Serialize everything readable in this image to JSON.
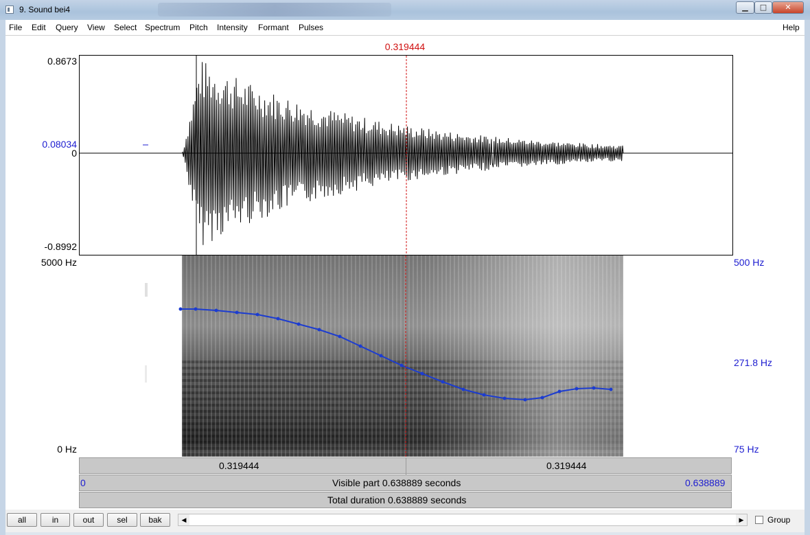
{
  "window": {
    "title": "9. Sound bei4",
    "min_glyph": "▁",
    "max_glyph": "□",
    "close_glyph": "✕"
  },
  "menu": {
    "items": [
      "File",
      "Edit",
      "Query",
      "View",
      "Select",
      "Spectrum",
      "Pitch",
      "Intensity",
      "Formant",
      "Pulses"
    ],
    "help": "Help"
  },
  "cursor": {
    "time_label": "0.319444",
    "position_fraction": 0.5
  },
  "waveform": {
    "max_label": "0.8673",
    "cursor_value_label": "0.08034",
    "zero_label": "0",
    "min_label": "-0.8992"
  },
  "spectrogram": {
    "top_label": "5000 Hz",
    "bottom_label": "0 Hz",
    "pitch_top_label": "500 Hz",
    "pitch_mid_label": "271.8 Hz",
    "pitch_bottom_label": "75 Hz"
  },
  "time_bars": {
    "left_segment": "0.319444",
    "right_segment": "0.319444",
    "visible_start": "0",
    "visible_label": "Visible part 0.638889 seconds",
    "visible_end": "0.638889",
    "total_label": "Total duration 0.638889 seconds"
  },
  "toolbar": {
    "buttons": [
      "all",
      "in",
      "out",
      "sel",
      "bak"
    ],
    "scroll_left_glyph": "◀",
    "scroll_right_glyph": "▶",
    "group_label": "Group"
  },
  "colors": {
    "cursor": "#d01010",
    "pitch_line": "#1c3cd0",
    "axis_blue": "#1c1cd0"
  }
}
